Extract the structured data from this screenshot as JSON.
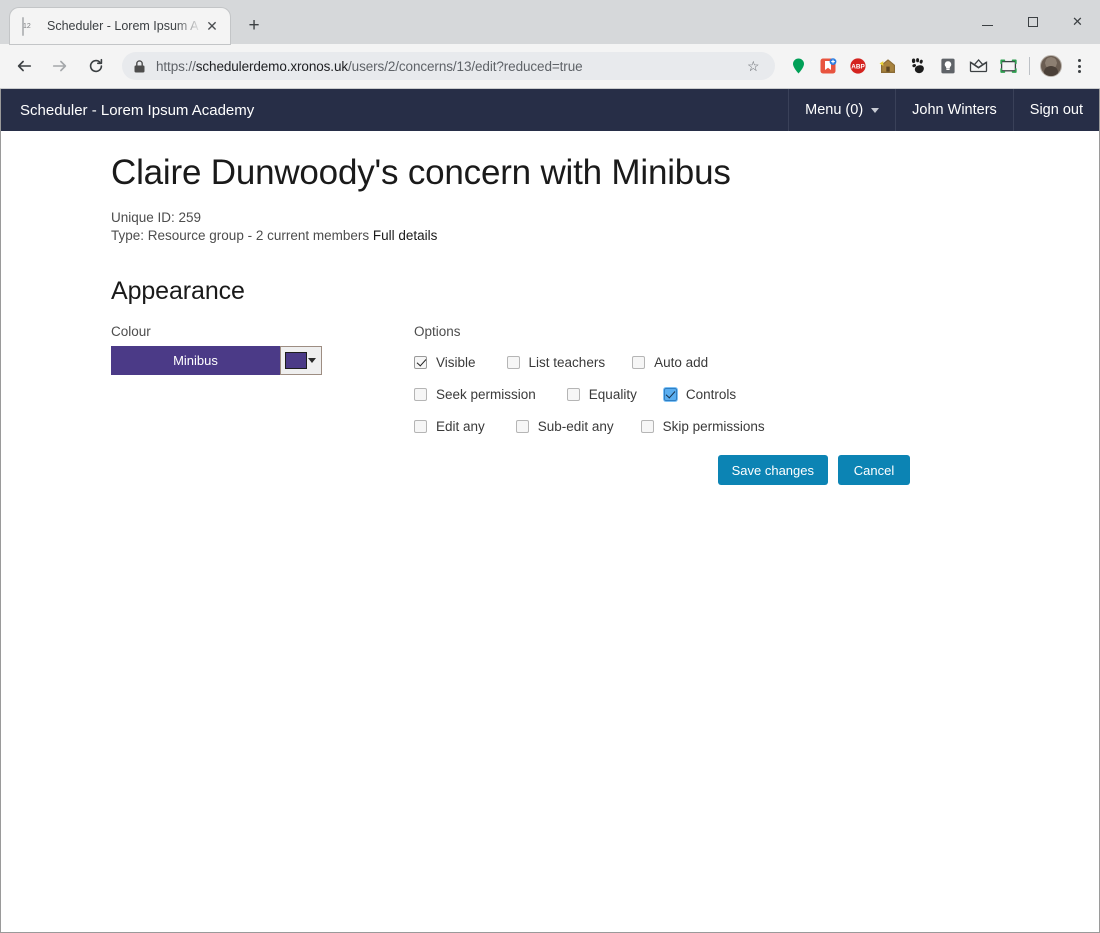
{
  "browser": {
    "tab": {
      "title": "Scheduler - Lorem Ipsum A",
      "favicon_name": "calendar-icon",
      "favicon_number": "12",
      "close_glyph": "✕"
    },
    "new_tab_glyph": "+",
    "window_controls": {
      "minimize": "–",
      "maximize": "□",
      "close": "✕"
    },
    "nav": {
      "back": "←",
      "forward": "→",
      "reload": "⟳"
    },
    "omnibox": {
      "scheme": "https://",
      "host": "schedulerdemo.xronos.uk",
      "path": "/users/2/concerns/13/edit?reduced=true",
      "full_url": "https://schedulerdemo.xronos.uk/users/2/concerns/13/edit?reduced=true",
      "lock_name": "lock-icon",
      "star_glyph": "☆"
    },
    "extensions": [
      {
        "name": "location-pin-extension-icon"
      },
      {
        "name": "bookmark-manager-extension-icon"
      },
      {
        "name": "adblock-plus-extension-icon",
        "label": "ABP"
      },
      {
        "name": "home-extension-icon"
      },
      {
        "name": "gnome-extension-icon"
      },
      {
        "name": "lightbulb-extension-icon"
      },
      {
        "name": "mail-envelope-extension-icon"
      },
      {
        "name": "screenshot-extension-icon"
      }
    ],
    "profile_name": "profile-avatar",
    "menu_name": "chrome-menu-icon"
  },
  "app": {
    "brand": "Scheduler - Lorem Ipsum Academy",
    "nav": {
      "menu": "Menu (0)",
      "user": "John Winters",
      "signout": "Sign out"
    }
  },
  "page": {
    "title": "Claire Dunwoody's concern with Minibus",
    "meta": {
      "unique_id": "Unique ID: 259",
      "type": "Type: Resource group - 2 current members",
      "full_details_link": "Full details"
    },
    "section_title": "Appearance"
  },
  "colour": {
    "label": "Colour",
    "name": "Minibus",
    "hex": "#4b3a87",
    "picker_name": "colour-picker-dropdown"
  },
  "options": {
    "label": "Options",
    "rows": [
      [
        {
          "label": "Visible",
          "checked": true,
          "focused": false
        },
        {
          "label": "List teachers",
          "checked": false,
          "focused": false
        },
        {
          "label": "Auto add",
          "checked": false,
          "focused": false
        }
      ],
      [
        {
          "label": "Seek permission",
          "checked": false,
          "focused": false
        },
        {
          "label": "Equality",
          "checked": false,
          "focused": false
        },
        {
          "label": "Controls",
          "checked": true,
          "focused": true
        }
      ],
      [
        {
          "label": "Edit any",
          "checked": false,
          "focused": false
        },
        {
          "label": "Sub-edit any",
          "checked": false,
          "focused": false
        },
        {
          "label": "Skip permissions",
          "checked": false,
          "focused": false
        }
      ]
    ]
  },
  "buttons": {
    "save": "Save changes",
    "cancel": "Cancel",
    "accent": "#0c84b4"
  }
}
